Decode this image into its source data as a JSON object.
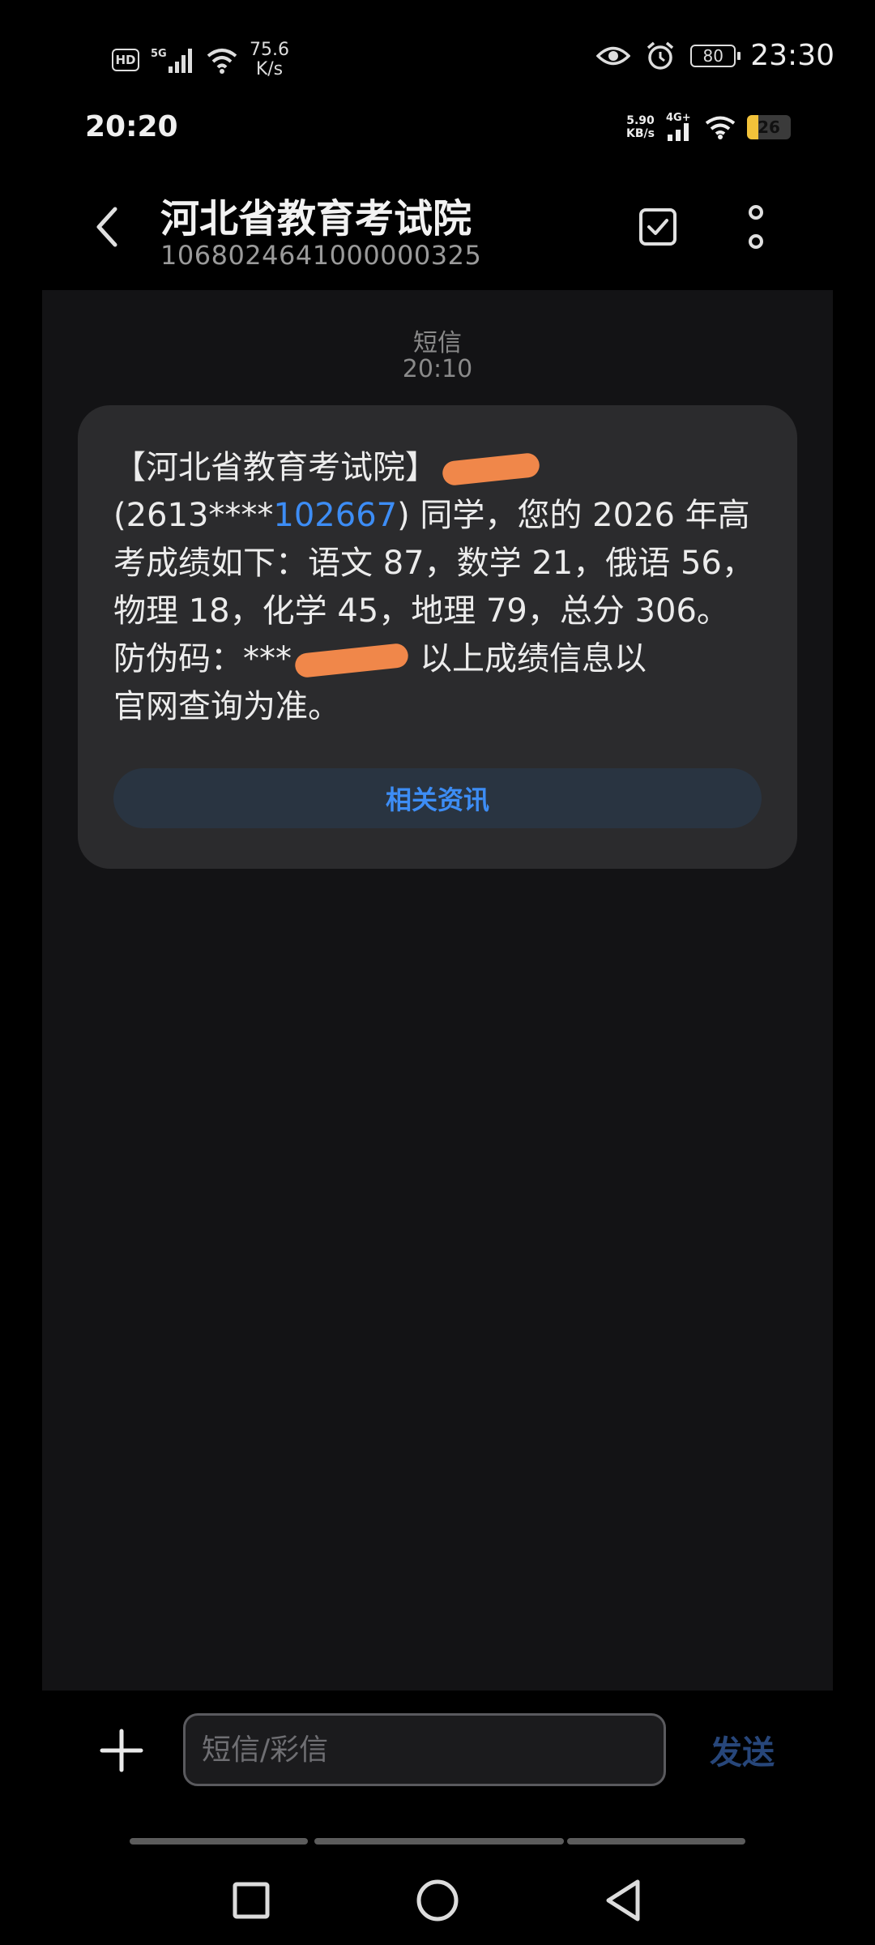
{
  "outer_status": {
    "net_speed_value": "75.6",
    "net_speed_unit": "K/s",
    "battery_level": "80",
    "time": "23:30",
    "icons": [
      "hd-icon",
      "5g-signal-icon",
      "wifi-icon",
      "eye-icon",
      "alarm-icon",
      "battery-icon"
    ]
  },
  "inner_status": {
    "time": "20:20",
    "net_speed_value": "5.90",
    "net_speed_unit": "KB/s",
    "network": "4G+",
    "battery_level": "26",
    "battery_fill_fraction": 0.26,
    "battery_color": "#f2c23a"
  },
  "header": {
    "contact_name": "河北省教育考试院",
    "contact_number": "1068024641000000325",
    "icons": [
      "back-arrow-icon",
      "select-checkbox-icon",
      "more-vertical-icon"
    ]
  },
  "conversation": {
    "message_type": "短信",
    "timestamp": "20:10",
    "message": {
      "line1_prefix": "【河北省教育考试院】",
      "line2_open": "(2613****",
      "line2_link": "102667",
      "line2_rest": ") 同学，您的 2026 年高",
      "line3": "考成绩如下：语文 87，数学 21，俄语 56，",
      "line4": "物理 18，化学 45，地理 79，总分 306。",
      "line5_prefix": "防伪码：***",
      "line5_suffix": "以上成绩信息以",
      "line6": "官网查询为准。"
    },
    "related_button": "相关资讯",
    "link_color": "#3d8df5",
    "redaction_color": "#f0874a"
  },
  "composer": {
    "placeholder": "短信/彩信",
    "send_label": "发送",
    "icons": [
      "plus-icon"
    ]
  },
  "navbar": {
    "icons": [
      "recent-apps-square-icon",
      "home-circle-icon",
      "back-triangle-icon"
    ]
  }
}
